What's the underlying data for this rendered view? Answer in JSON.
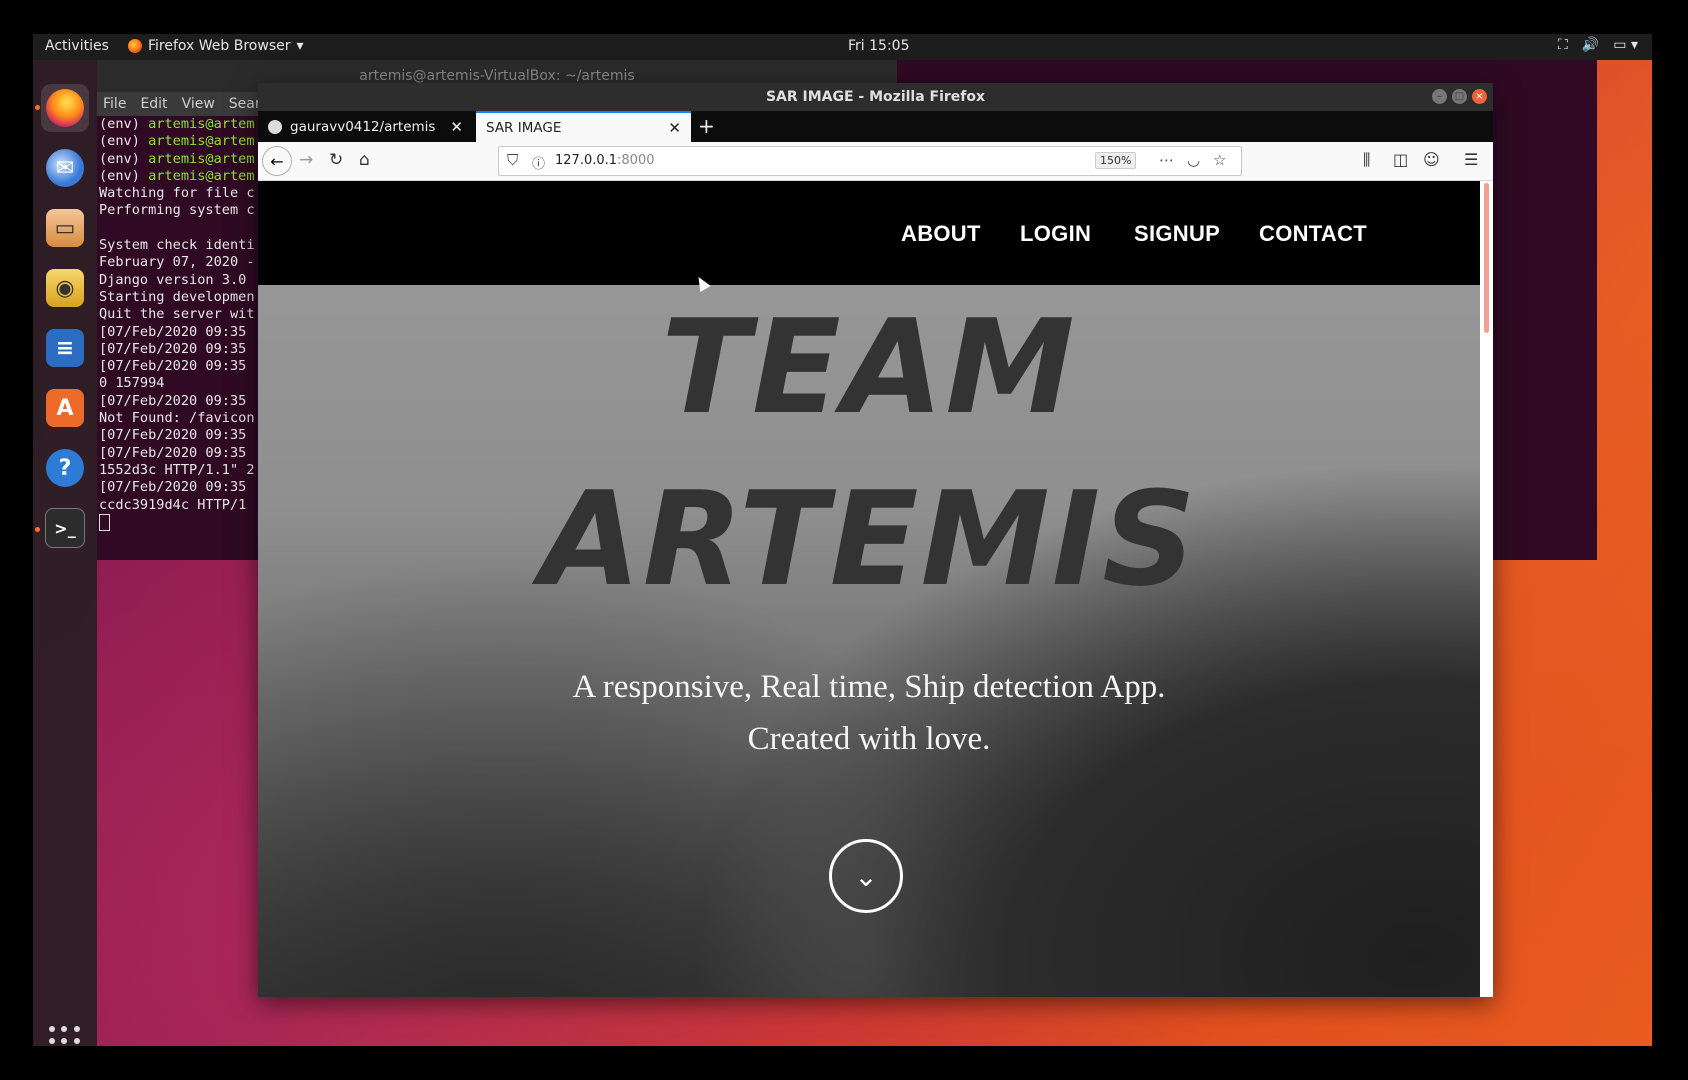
{
  "desktop": {
    "activities": "Activities",
    "app_menu": "Firefox Web Browser",
    "clock": "Fri 15:05"
  },
  "dock": {
    "items": [
      "firefox-icon",
      "thunderbird-icon",
      "files-icon",
      "rhythmbox-icon",
      "writer-icon",
      "software-icon",
      "help-icon",
      "terminal-icon",
      "apps-grid-icon"
    ]
  },
  "terminal": {
    "title": "artemis@artemis-VirtualBox: ~/artemis",
    "menu": [
      "File",
      "Edit",
      "View",
      "Search"
    ],
    "lines": [
      {
        "prefix": "(env) ",
        "text": "artemis@artem"
      },
      {
        "prefix": "(env) ",
        "text": "artemis@artem"
      },
      {
        "prefix": "(env) ",
        "text": "artemis@artem"
      },
      {
        "prefix": "(env) ",
        "text": "artemis@artem"
      },
      {
        "prefix": "",
        "text": "Watching for file c"
      },
      {
        "prefix": "",
        "text": "Performing system c"
      },
      {
        "prefix": "",
        "text": ""
      },
      {
        "prefix": "",
        "text": "System check identi"
      },
      {
        "prefix": "",
        "text": "February 07, 2020 -"
      },
      {
        "prefix": "",
        "text": "Django version 3.0"
      },
      {
        "prefix": "",
        "text": "Starting developmen"
      },
      {
        "prefix": "",
        "text": "Quit the server wit"
      },
      {
        "prefix": "",
        "text": "[07/Feb/2020 09:35"
      },
      {
        "prefix": "",
        "text": "[07/Feb/2020 09:35"
      },
      {
        "prefix": "",
        "text": "[07/Feb/2020 09:35"
      },
      {
        "prefix": "",
        "text": "0 157994"
      },
      {
        "prefix": "",
        "text": "[07/Feb/2020 09:35"
      },
      {
        "prefix": "",
        "text": "Not Found: /favicon"
      },
      {
        "prefix": "",
        "text": "[07/Feb/2020 09:35"
      },
      {
        "prefix": "",
        "text": "[07/Feb/2020 09:35"
      },
      {
        "prefix": "",
        "text": "1552d3c HTTP/1.1\" 2"
      },
      {
        "prefix": "",
        "text": "[07/Feb/2020 09:35"
      },
      {
        "prefix": "",
        "text": "ccdc3919d4c HTTP/1"
      }
    ]
  },
  "browser": {
    "window_title": "SAR IMAGE - Mozilla Firefox",
    "tabs": [
      {
        "label": "gauravv0412/artemis"
      },
      {
        "label": "SAR IMAGE"
      }
    ],
    "url_host": "127.0.0.1",
    "url_port": ":8000",
    "zoom": "150%"
  },
  "site": {
    "nav": [
      "ABOUT",
      "LOGIN",
      "SIGNUP",
      "CONTACT"
    ],
    "title_line1": "TEAM",
    "title_line2": "ARTEMIS",
    "subtitle_line1": "A responsive, Real time,  Ship detection App.",
    "subtitle_line2": "Created with love."
  }
}
